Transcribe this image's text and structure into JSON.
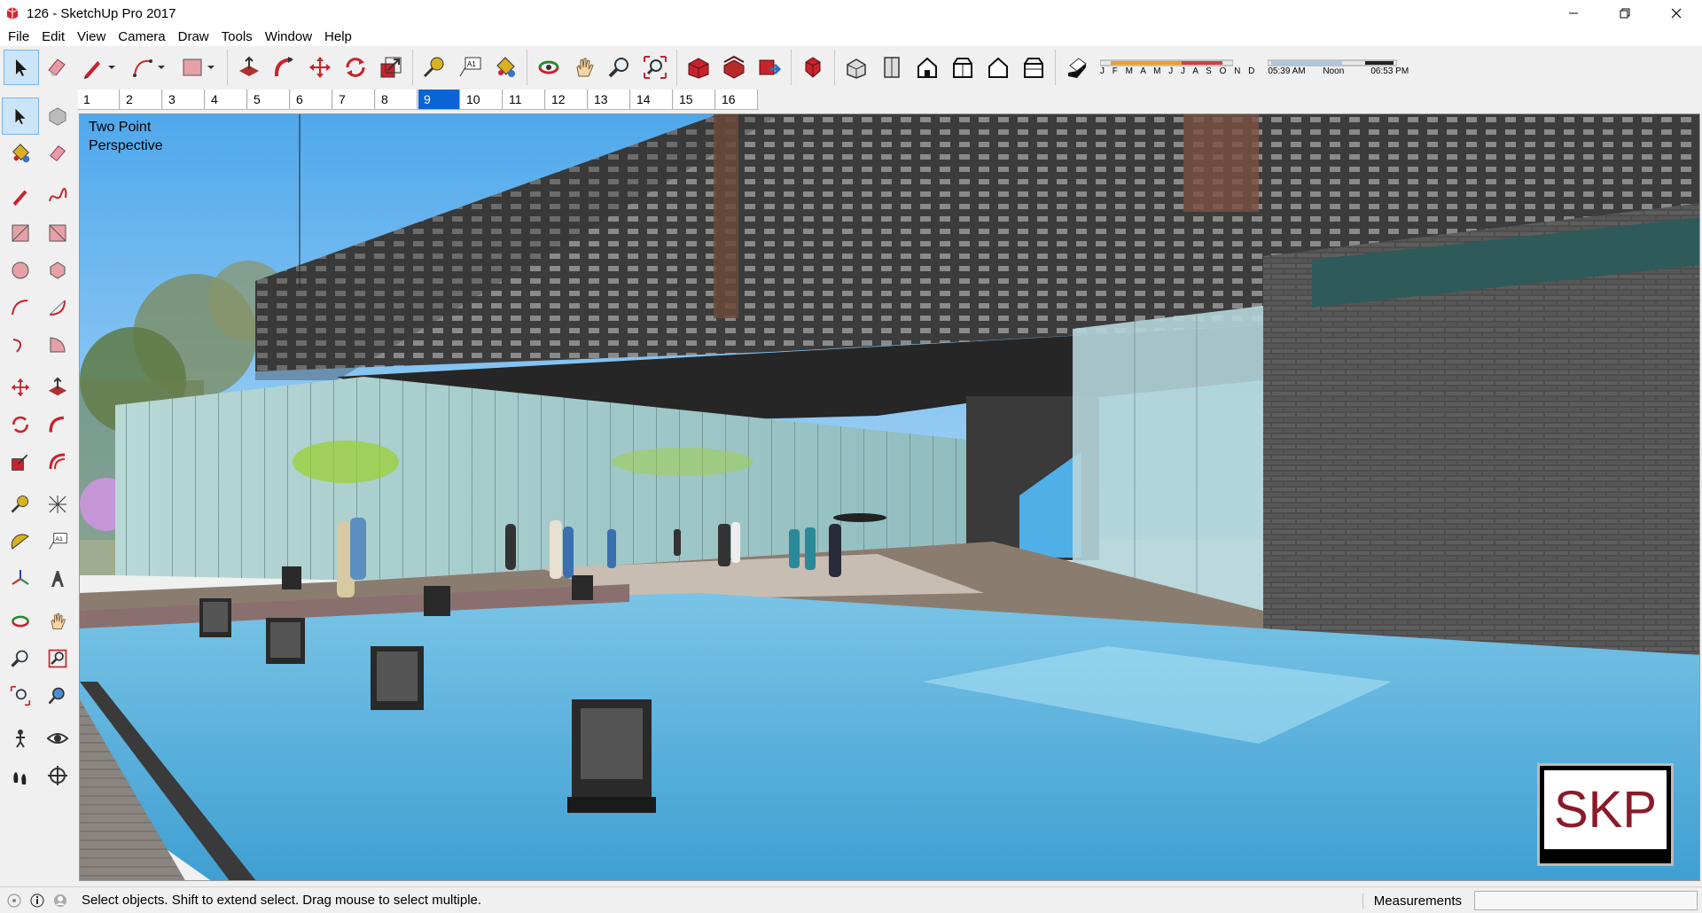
{
  "window": {
    "title": "126 - SketchUp Pro 2017"
  },
  "menu": [
    "File",
    "Edit",
    "View",
    "Camera",
    "Draw",
    "Tools",
    "Window",
    "Help"
  ],
  "shadows": {
    "months": "J F M A M J J A S O N D",
    "time_start": "05:39 AM",
    "time_mid": "Noon",
    "time_end": "06:53 PM"
  },
  "scenes": {
    "tabs": [
      "1",
      "2",
      "3",
      "4",
      "5",
      "6",
      "7",
      "8",
      "9",
      "10",
      "11",
      "12",
      "13",
      "14",
      "15",
      "16"
    ],
    "active": "9"
  },
  "viewport": {
    "camera_line1": "Two Point",
    "camera_line2": "Perspective",
    "watermark": "SKP"
  },
  "status": {
    "message": "Select objects. Shift to extend select. Drag mouse to select multiple.",
    "measurements_label": "Measurements",
    "measurements_value": ""
  },
  "colors": {
    "accent": "#0a64d6",
    "sky": "#6ab7ee",
    "water": "#5ab3df",
    "brick": "#4a4a4a",
    "glass": "#9ec8c9",
    "skp_text": "#8a1a2a"
  },
  "icons": {
    "toolbar": [
      "select-icon",
      "eraser-icon",
      "pencil-icon",
      "arc-icon",
      "rectangle-icon",
      "push-pull-icon",
      "follow-me-icon",
      "move-icon",
      "rotate-icon",
      "scale-icon",
      "tape-measure-icon",
      "text-icon",
      "paint-bucket-icon",
      "orbit-icon",
      "pan-icon",
      "zoom-icon",
      "zoom-extents-icon",
      "warehouse-icon",
      "share-model-icon",
      "extension-icon",
      "ruby-icon",
      "iso-view-icon",
      "top-view-icon",
      "front-view-icon",
      "right-view-icon",
      "back-view-icon",
      "left-view-icon",
      "shadow-toggle-icon"
    ]
  }
}
